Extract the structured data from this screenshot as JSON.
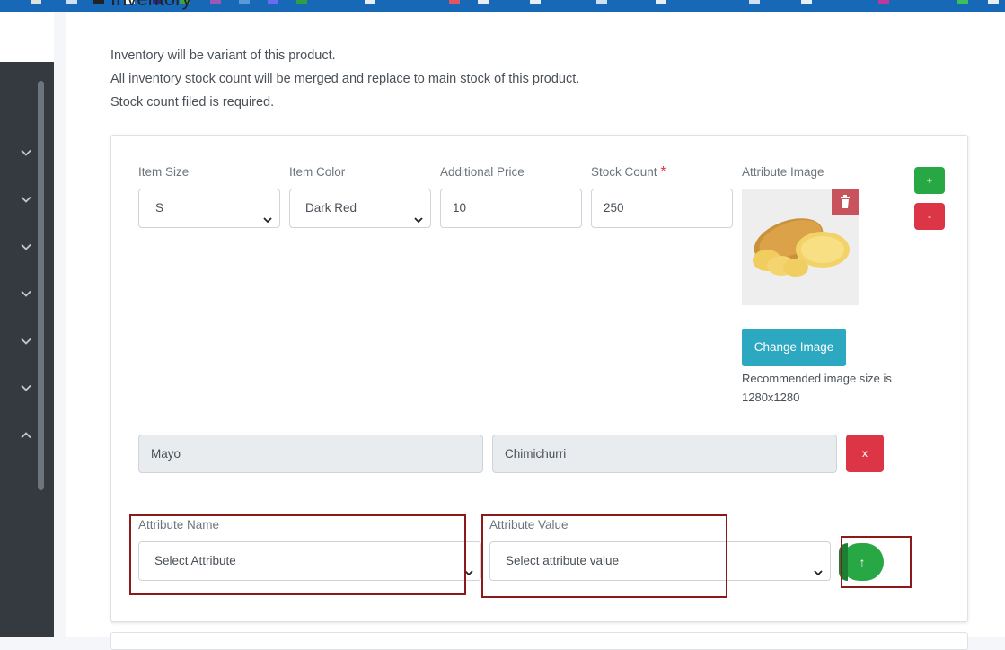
{
  "page": {
    "heading": "Inventory",
    "notes": [
      "Inventory will be variant of this product.",
      "All inventory stock count will be merged and replace to main stock of this product.",
      "Stock count filed is required."
    ]
  },
  "inventory_row": {
    "item_size": {
      "label": "Item Size",
      "value": "S"
    },
    "item_color": {
      "label": "Item Color",
      "value": "Dark Red"
    },
    "additional_price": {
      "label": "Additional Price",
      "value": "10"
    },
    "stock_count": {
      "label": "Stock Count",
      "required_mark": "*",
      "value": "250"
    },
    "attribute_image": {
      "label": "Attribute Image",
      "change_button": "Change Image",
      "hint": "Recommended image size is 1280x1280"
    },
    "add_button": "+",
    "remove_button": "-"
  },
  "attribute_pair": {
    "name": "Mayo",
    "value": "Chimichurri",
    "remove_button": "x"
  },
  "new_attribute": {
    "name_label": "Attribute Name",
    "name_placeholder": "Select Attribute",
    "value_label": "Attribute Value",
    "value_placeholder": "Select attribute value",
    "add_button_icon": "↑"
  },
  "colors": {
    "topbar": "#1769b8",
    "sidebar": "#343a40",
    "success": "#28a745",
    "danger": "#dc3545",
    "info": "#2ca8c0",
    "highlight": "#8b1a1a"
  }
}
